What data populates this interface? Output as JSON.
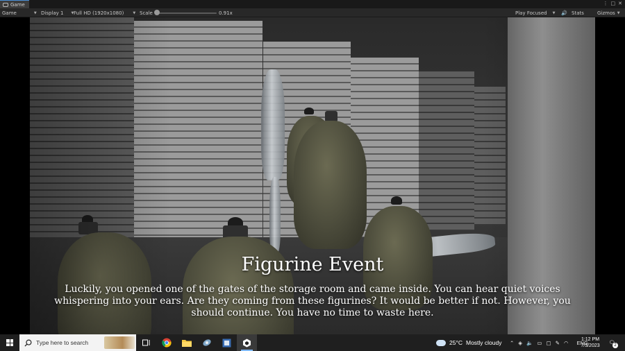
{
  "unity": {
    "tab_label": "Game",
    "toolbar": {
      "view_mode": "Game",
      "display": "Display 1",
      "resolution": "Full HD (1920x1080)",
      "scale_label": "Scale",
      "scale_value": "0.91x",
      "play_mode": "Play Focused",
      "stats_label": "Stats",
      "gizmos_label": "Gizmos"
    }
  },
  "game": {
    "event_title": "Figurine Event",
    "event_body": "Luckily, you opened one of the gates of the storage room and came inside. You can hear quiet voices whispering into your ears. Are they coming from these figurines? It would be better if not. However, you should continue. You have no time to waste here."
  },
  "taskbar": {
    "search_placeholder": "Type here to search",
    "apps": [
      {
        "name": "task-view-icon"
      },
      {
        "name": "chrome-icon"
      },
      {
        "name": "file-explorer-icon"
      },
      {
        "name": "app-icon"
      },
      {
        "name": "app-icon-2"
      },
      {
        "name": "unity-icon",
        "active": true
      }
    ],
    "weather_temp": "25°C",
    "weather_desc": "Mostly cloudy",
    "language": "ENG",
    "time": "1:12 PM",
    "date": "7/3/2023",
    "notification_count": "2"
  }
}
